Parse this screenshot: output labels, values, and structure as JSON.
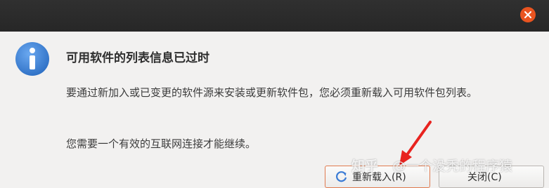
{
  "dialog": {
    "heading": "可用软件的列表信息已过时",
    "message1": "要通过新加入或已变更的软件源来安装或更新软件包，您必须重新载入可用软件包列表。",
    "message2": "您需要一个有效的互联网连接才能继续。",
    "reload_button": "重新载入(R)",
    "close_button": "关闭(C)"
  },
  "icons": {
    "titlebar_close": "close-icon",
    "info": "info-icon",
    "reload": "reload-icon"
  },
  "colors": {
    "accent": "#e95420",
    "info_blue": "#3a7bd5",
    "titlebar": "#2d2d2d",
    "background": "#f2f1f0",
    "annotation_arrow": "#e8231f"
  },
  "watermark": {
    "logo": "知乎",
    "author": "@一个没秃的程序猿"
  }
}
